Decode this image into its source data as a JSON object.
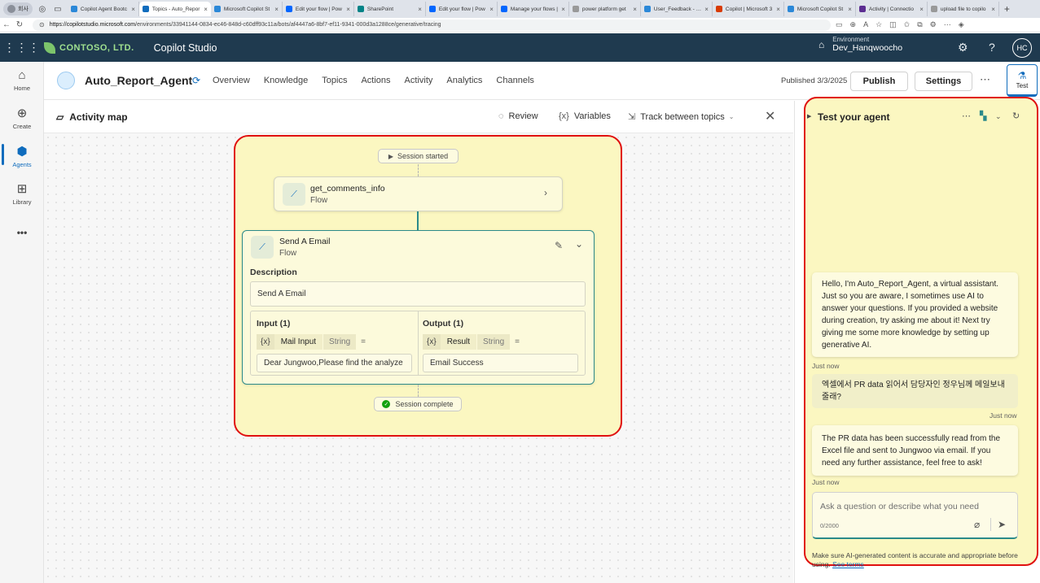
{
  "browser": {
    "profile": "회사",
    "tabs": [
      {
        "label": "Copilot Agent Bootc",
        "color": "#2b88d8"
      },
      {
        "label": "Topics - Auto_Repor",
        "color": "#0f6cbd",
        "active": true
      },
      {
        "label": "Microsoft Copilot St",
        "color": "#2b88d8"
      },
      {
        "label": "Edit your flow | Pow",
        "color": "#0066ff"
      },
      {
        "label": "SharePoint",
        "color": "#038387"
      },
      {
        "label": "Edit your flow | Pow",
        "color": "#0066ff"
      },
      {
        "label": "Manage your flows |",
        "color": "#0066ff"
      },
      {
        "label": "power platform get",
        "color": "#999999"
      },
      {
        "label": "User_Feedback - Co",
        "color": "#2b88d8"
      },
      {
        "label": "Copilot | Microsoft 3",
        "color": "#d83b01"
      },
      {
        "label": "Microsoft Copilot St",
        "color": "#2b88d8"
      },
      {
        "label": "Activity | Connectio",
        "color": "#5c2d91"
      },
      {
        "label": "upload file to copilo",
        "color": "#999999"
      }
    ],
    "url_domain": "https://copilotstudio.microsoft.com",
    "url_path": "/environments/33941144-0834-ec46-848d-c60dff93c11a/bots/af4447a6-8bf7-ef11-9341-000d3a1288ce/generative/tracing"
  },
  "header": {
    "company": "CONTOSO, LTD.",
    "product": "Copilot Studio",
    "env_label": "Environment",
    "env_name": "Dev_Hanqwoocho",
    "avatar": "HC"
  },
  "leftnav": {
    "items": [
      {
        "label": "Home",
        "icon": "home-icon"
      },
      {
        "label": "Create",
        "icon": "plus-icon"
      },
      {
        "label": "Agents",
        "icon": "agent-icon",
        "selected": true
      },
      {
        "label": "Library",
        "icon": "library-icon"
      }
    ],
    "more": "•••"
  },
  "agentbar": {
    "name": "Auto_Report_Agent",
    "tabs": [
      "Overview",
      "Knowledge",
      "Topics",
      "Actions",
      "Activity",
      "Analytics",
      "Channels"
    ],
    "published": "Published 3/3/2025",
    "publish_label": "Publish",
    "settings_label": "Settings",
    "test_label": "Test"
  },
  "activitymap": {
    "title": "Activity map",
    "review": "Review",
    "variables": "Variables",
    "track": "Track between topics"
  },
  "flow": {
    "start": "Session started",
    "node1": {
      "title": "get_comments_info",
      "type": "Flow"
    },
    "node2": {
      "title": "Send A Email",
      "type": "Flow",
      "desc_label": "Description",
      "desc_value": "Send A Email",
      "input_label": "Input (1)",
      "input_var": "{x}",
      "input_name": "Mail Input",
      "input_type": "String",
      "input_value": "Dear Jungwoo,Please find the analyze",
      "output_label": "Output (1)",
      "output_var": "{x}",
      "output_name": "Result",
      "output_type": "String",
      "output_value": "Email Success"
    },
    "end": "Session complete"
  },
  "testpanel": {
    "title": "Test your agent",
    "messages": [
      {
        "text": "Hello, I'm Auto_Report_Agent, a virtual assistant. Just so you are aware, I sometimes use AI to answer your questions. If you provided a website during creation, try asking me about it! Next try giving me some more knowledge by setting up generative AI.",
        "time": "Just now"
      },
      {
        "text": "엑셀에서 PR data 읽어서 담당자인 정우님께 메일보내 줄래?",
        "time": "Just now"
      },
      {
        "text": "The PR data has been successfully read from the Excel file and sent to Jungwoo via email. If you need any further assistance, feel free to ask!",
        "time": "Just now"
      }
    ],
    "placeholder": "Ask a question or describe what you need",
    "counter": "0/2000",
    "disclaimer": "Make sure AI-generated content is accurate and appropriate before using.",
    "disclaimer_link": "See terms"
  },
  "colors": {
    "accent": "#0f6cbd",
    "header": "#1f3a4f",
    "highlight": "#e01010",
    "teal": "#2b8a8a"
  }
}
